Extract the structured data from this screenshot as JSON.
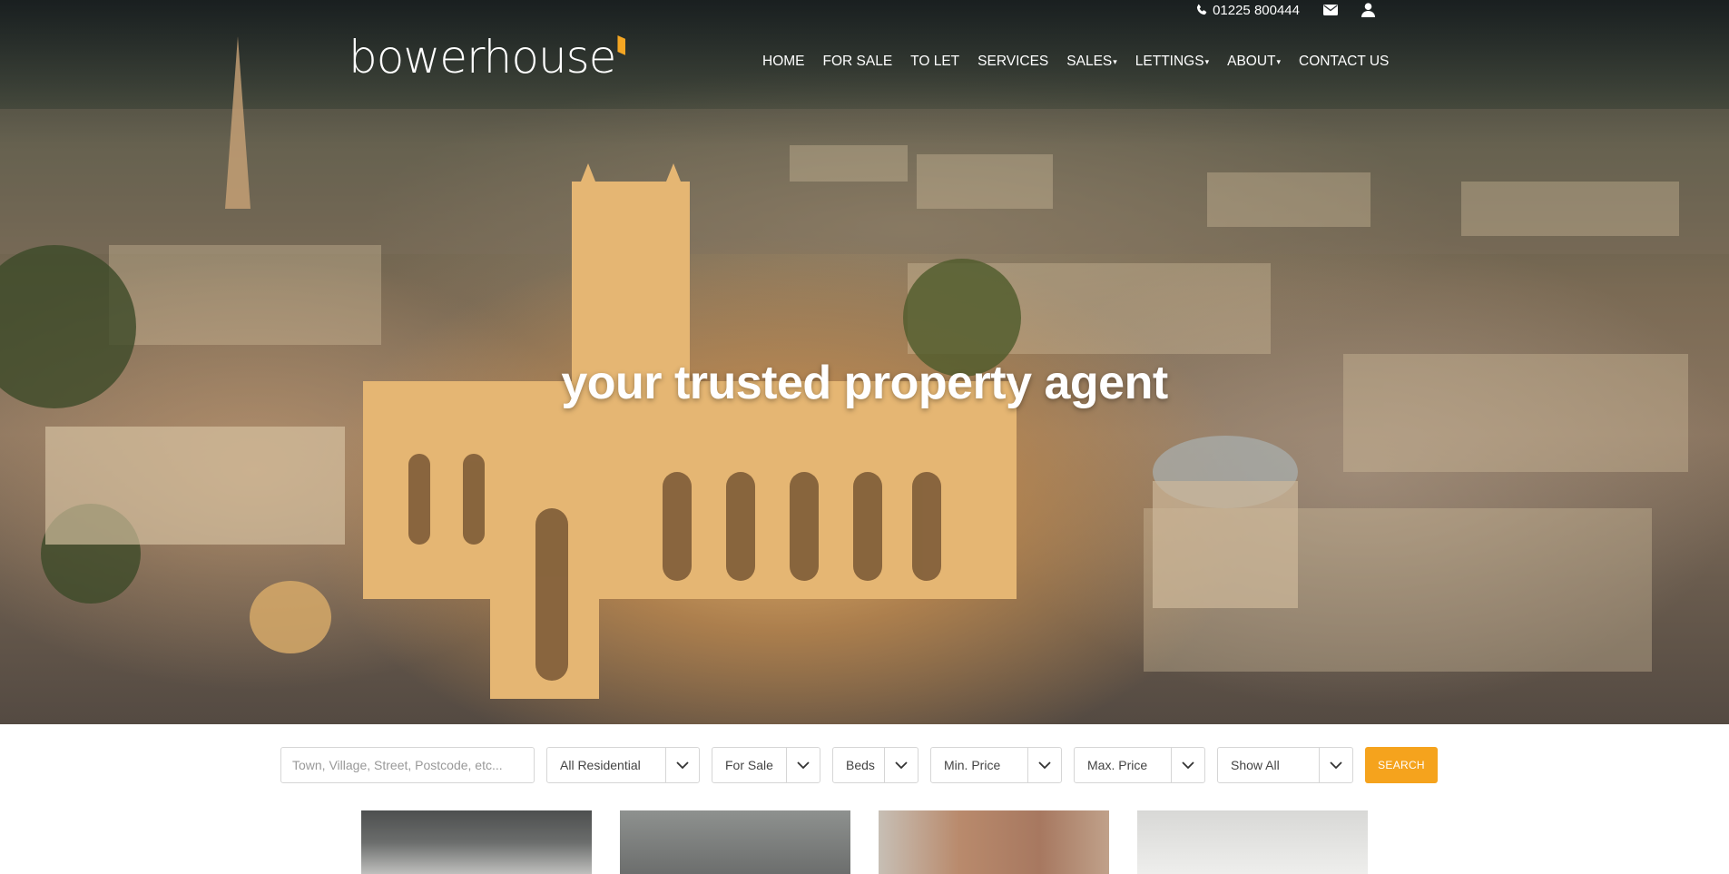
{
  "header": {
    "phone": "01225 800444",
    "logo": "bowerhouse",
    "nav": [
      {
        "label": "HOME",
        "dropdown": false
      },
      {
        "label": "FOR SALE",
        "dropdown": false
      },
      {
        "label": "TO LET",
        "dropdown": false
      },
      {
        "label": "SERVICES",
        "dropdown": false
      },
      {
        "label": "SALES",
        "dropdown": true
      },
      {
        "label": "LETTINGS",
        "dropdown": true
      },
      {
        "label": "ABOUT",
        "dropdown": true
      },
      {
        "label": "CONTACT US",
        "dropdown": false
      }
    ],
    "icons": [
      "phone-icon",
      "envelope-icon",
      "user-icon"
    ]
  },
  "hero": {
    "tagline": "your trusted property agent"
  },
  "search": {
    "placeholder": "Town, Village, Street, Postcode, etc...",
    "type": "All Residential",
    "status": "For Sale",
    "beds": "Beds",
    "min_price": "Min. Price",
    "max_price": "Max. Price",
    "show": "Show All",
    "button": "SEARCH"
  },
  "colors": {
    "accent": "#f5a31d",
    "text": "#444444",
    "border": "#d6d6d6"
  }
}
